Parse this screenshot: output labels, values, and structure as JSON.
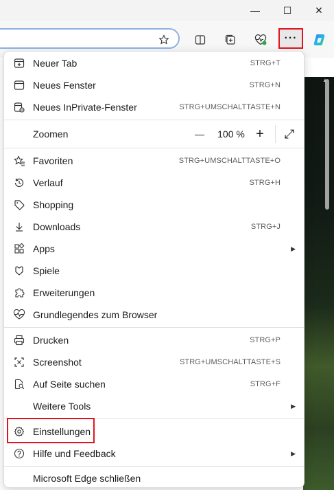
{
  "window": {
    "minimize_glyph": "—",
    "maximize_glyph": "☐",
    "close_glyph": "✕"
  },
  "toolbar": {
    "more_glyph": "···"
  },
  "menu": {
    "items": [
      {
        "label": "Neuer Tab",
        "shortcut": "STRG+T",
        "icon": "new-tab-icon"
      },
      {
        "label": "Neues Fenster",
        "shortcut": "STRG+N",
        "icon": "new-window-icon"
      },
      {
        "label": "Neues InPrivate-Fenster",
        "shortcut": "STRG+UMSCHALTTASTE+N",
        "icon": "inprivate-icon"
      }
    ],
    "zoom": {
      "label": "Zoomen",
      "minus": "—",
      "value": "100 %",
      "plus": "+",
      "expand_glyph": "⤢"
    },
    "group2": [
      {
        "label": "Favoriten",
        "shortcut": "STRG+UMSCHALTTASTE+O",
        "icon": "favorites-icon"
      },
      {
        "label": "Verlauf",
        "shortcut": "STRG+H",
        "icon": "history-icon"
      },
      {
        "label": "Shopping",
        "shortcut": "",
        "icon": "shopping-tag-icon"
      },
      {
        "label": "Downloads",
        "shortcut": "STRG+J",
        "icon": "download-icon"
      },
      {
        "label": "Apps",
        "shortcut": "",
        "icon": "apps-icon",
        "submenu": true
      },
      {
        "label": "Spiele",
        "shortcut": "",
        "icon": "games-icon"
      },
      {
        "label": "Erweiterungen",
        "shortcut": "",
        "icon": "extensions-icon"
      },
      {
        "label": "Grundlegendes zum Browser",
        "shortcut": "",
        "icon": "browser-essentials-icon"
      }
    ],
    "group3": [
      {
        "label": "Drucken",
        "shortcut": "STRG+P",
        "icon": "print-icon"
      },
      {
        "label": "Screenshot",
        "shortcut": "STRG+UMSCHALTTASTE+S",
        "icon": "screenshot-icon"
      },
      {
        "label": "Auf Seite suchen",
        "shortcut": "STRG+F",
        "icon": "find-icon"
      },
      {
        "label": "Weitere Tools",
        "shortcut": "",
        "icon": "",
        "submenu": true
      }
    ],
    "group4": [
      {
        "label": "Einstellungen",
        "shortcut": "",
        "icon": "settings-gear-icon"
      },
      {
        "label": "Hilfe und Feedback",
        "shortcut": "",
        "icon": "help-icon",
        "submenu": true
      }
    ],
    "close": {
      "label": "Microsoft Edge schließen"
    }
  },
  "colors": {
    "highlight": "#e0141e",
    "address_border": "#8fb0e6"
  }
}
